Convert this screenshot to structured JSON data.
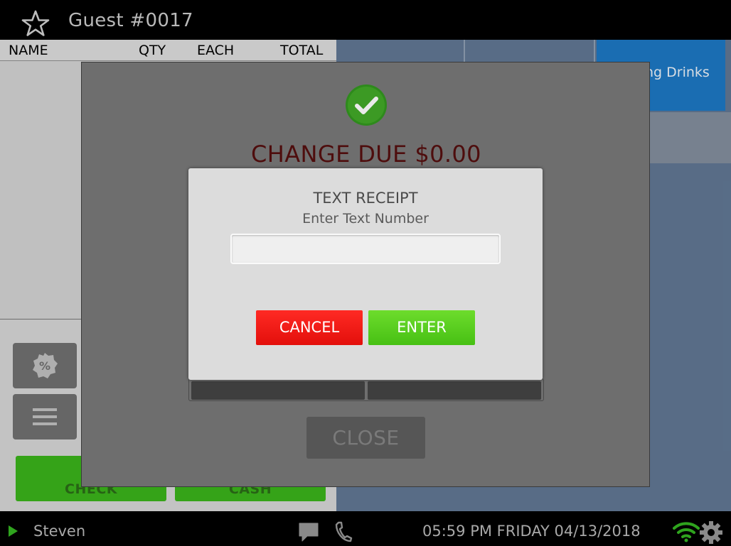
{
  "header": {
    "guest_title": "Guest #0017"
  },
  "order": {
    "columns": {
      "name": "NAME",
      "qty": "QTY",
      "each": "EACH",
      "total": "TOTAL"
    },
    "pay_buttons": {
      "check": "CHECK",
      "cash": "CASH"
    }
  },
  "categories": {
    "tile_3_label": "ng Drinks"
  },
  "payment_modal": {
    "change_due": "CHANGE DUE $0.00",
    "close_label": "CLOSE"
  },
  "text_receipt": {
    "title": "TEXT RECEIPT",
    "subtitle": "Enter Text Number",
    "input_value": "",
    "cancel_label": "CANCEL",
    "enter_label": "ENTER"
  },
  "status": {
    "user": "Steven",
    "datetime": "05:59 PM FRIDAY 04/13/2018"
  },
  "colors": {
    "accent_green": "#47c014",
    "accent_red": "#e30f0b",
    "change_due_red": "#4e0d0d",
    "tile_blue": "#1d76c0"
  },
  "icons": [
    "star-icon",
    "check-circle-icon",
    "discount-badge-icon",
    "menu-icon",
    "play-icon",
    "chat-icon",
    "phone-icon",
    "wifi-icon",
    "gear-icon"
  ]
}
